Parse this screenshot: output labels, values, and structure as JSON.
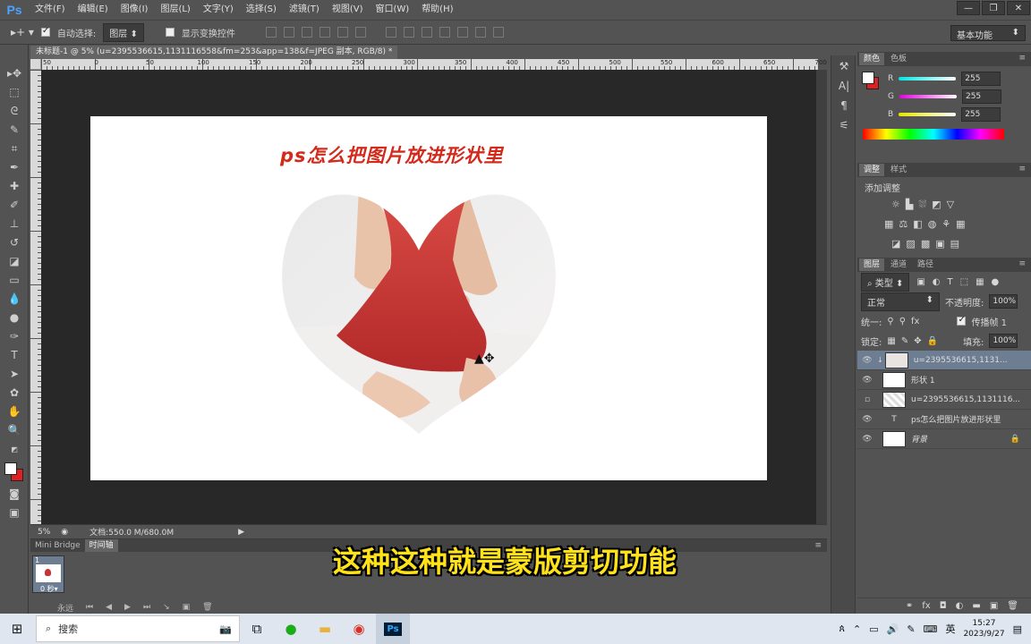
{
  "app": {
    "logo": "Ps",
    "menu": [
      "文件(F)",
      "编辑(E)",
      "图像(I)",
      "图层(L)",
      "文字(Y)",
      "选择(S)",
      "滤镜(T)",
      "视图(V)",
      "窗口(W)",
      "帮助(H)"
    ],
    "window_controls": [
      "—",
      "❐",
      "✕"
    ]
  },
  "options_bar": {
    "auto_select_label": "自动选择:",
    "auto_select_checked": true,
    "auto_select_target": "图层",
    "show_transform_label": "显示变换控件",
    "show_transform_checked": false,
    "workspace": "基本功能"
  },
  "document": {
    "tab_title": "未标题-1 @ 5% (u=2395536615,1131116558&fm=253&app=138&f=JPEG 副本, RGB/8) *",
    "ruler_ticks": [
      "50",
      "0",
      "50",
      "100",
      "150",
      "200",
      "250",
      "300",
      "350",
      "400",
      "450",
      "500",
      "550",
      "600",
      "650",
      "700"
    ],
    "canvas_heading": "ps怎么把图片放进形状里",
    "zoom": "5%",
    "doc_size": "文档:550.0 M/680.0M"
  },
  "timeline": {
    "tabs": [
      "Mini Bridge",
      "时间轴"
    ],
    "frame_number": "1",
    "frame_delay": "0 秒▾",
    "loop": "永远"
  },
  "color_panel": {
    "tabs": [
      "颜色",
      "色板"
    ],
    "channels": [
      {
        "label": "R",
        "value": "255",
        "gradient": "#00e5e5"
      },
      {
        "label": "G",
        "value": "255",
        "gradient": "#e500e5"
      },
      {
        "label": "B",
        "value": "255",
        "gradient": "#e5e500"
      }
    ]
  },
  "adjust_panel": {
    "tabs": [
      "调整",
      "样式"
    ],
    "title": "添加调整"
  },
  "layers_panel": {
    "tabs": [
      "图层",
      "通道",
      "路径"
    ],
    "filter_kind": "类型",
    "blend_mode": "正常",
    "opacity_label": "不透明度:",
    "opacity": "100%",
    "unify_label": "统一:",
    "propagate_label": "传播帧 1",
    "lock_label": "锁定:",
    "fill_label": "填充:",
    "fill": "100%",
    "layers": [
      {
        "name": "u=2395536615,1131...",
        "visible": true,
        "selected": true,
        "clipped": true
      },
      {
        "name": "形状 1",
        "visible": true,
        "selected": false,
        "clipped": false
      },
      {
        "name": "u=2395536615,1131116...",
        "visible": false,
        "selected": false,
        "clipped": false
      },
      {
        "name": "ps怎么把图片放进形状里",
        "visible": true,
        "selected": false,
        "clipped": false,
        "text": true
      },
      {
        "name": "背景",
        "visible": true,
        "selected": false,
        "clipped": false,
        "locked": true
      }
    ]
  },
  "taskbar": {
    "search_placeholder": "搜索",
    "ime": "英",
    "time": "15:27",
    "date": "2023/9/27"
  },
  "subtitle": "这种这种就是蒙版剪切功能",
  "colors": {
    "heading_red": "#d42a1c",
    "dress_red": "#c93434",
    "subtitle_yellow": "#ffe21a"
  }
}
